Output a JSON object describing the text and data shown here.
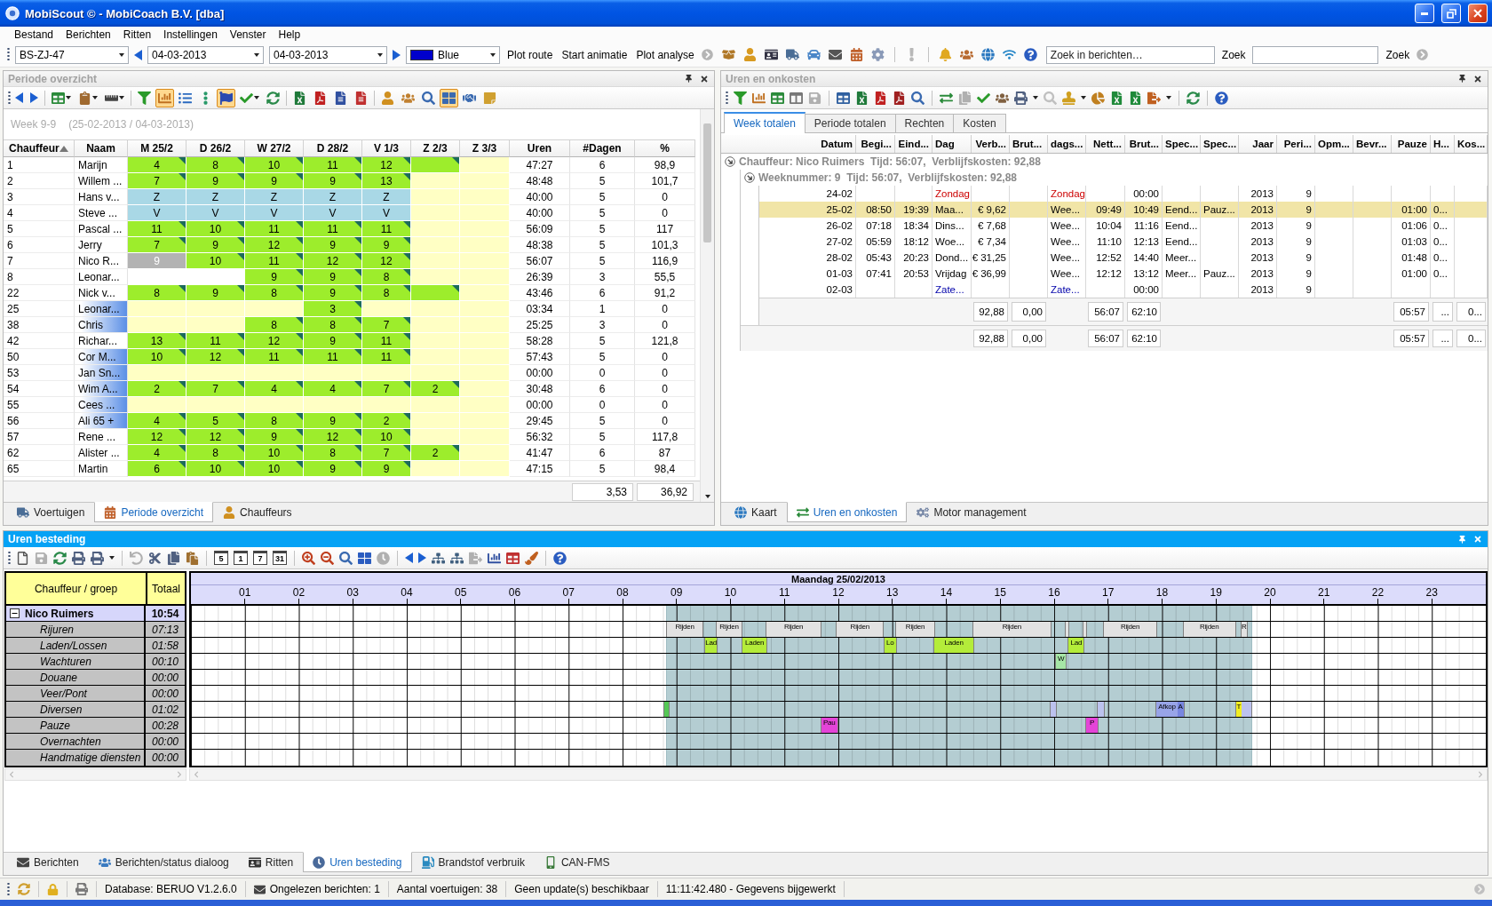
{
  "window": {
    "title": "MobiScout © - MobiCoach B.V. [dba]"
  },
  "menu": [
    "Bestand",
    "Berichten",
    "Ritten",
    "Instellingen",
    "Venster",
    "Help"
  ],
  "toolbar": {
    "vehicle": "BS-ZJ-47",
    "date_from": "04-03-2013",
    "date_to": "04-03-2013",
    "plot_color": {
      "label": "Blue",
      "color": "#0000cc"
    },
    "actions": [
      "Plot route",
      "Start animatie",
      "Plot analyse"
    ],
    "message_search": {
      "placeholder": "Zoek in berichten…",
      "button": "Zoek"
    },
    "search": {
      "button": "Zoek"
    }
  },
  "periode_overzicht": {
    "title": "Periode overzicht",
    "active": false,
    "toolbar": [
      {
        "selected": false
      },
      {
        "selected": false
      },
      {
        "selected": false
      },
      {
        "selected": false
      },
      {
        "selected": false
      },
      {
        "selected": false
      },
      {
        "selected": true
      },
      {
        "selected": false
      },
      {
        "selected": false
      },
      {
        "selected": true
      },
      {
        "selected": false
      },
      {
        "selected": false
      },
      {
        "selected": false
      },
      {
        "selected": false
      },
      {
        "selected": false
      },
      {
        "selected": false
      },
      {
        "selected": false
      },
      {
        "selected": false
      },
      {
        "selected": false
      },
      {
        "selected": true
      },
      {
        "selected": false
      },
      {
        "selected": false
      }
    ],
    "week": "Week 9-9",
    "range": "(25-02-2013 / 04-03-2013)",
    "columns": [
      {
        "label": "Chauffeur",
        "sorted": true
      },
      {
        "label": "Naam",
        "sorted": false
      },
      {
        "label": "M 25/2",
        "sorted": false
      },
      {
        "label": "D 26/2",
        "sorted": false
      },
      {
        "label": "W 27/2",
        "sorted": false
      },
      {
        "label": "D 28/2",
        "sorted": false
      },
      {
        "label": "V 1/3",
        "sorted": false
      },
      {
        "label": "Z 2/3",
        "sorted": false
      },
      {
        "label": "Z 3/3",
        "sorted": false
      },
      {
        "label": "Uren",
        "sorted": false
      },
      {
        "label": "#Dagen",
        "sorted": false
      },
      {
        "label": "%",
        "sorted": false
      }
    ],
    "rows": [
      {
        "id": "1",
        "name": "Marijn",
        "marked": false,
        "days": [
          {
            "kind": "worked",
            "value": "4"
          },
          {
            "kind": "worked",
            "value": "8"
          },
          {
            "kind": "worked",
            "value": "10"
          },
          {
            "kind": "worked",
            "value": "11"
          },
          {
            "kind": "worked",
            "value": "12"
          },
          {
            "kind": "worked"
          },
          {
            "kind": "free"
          }
        ],
        "hours": "47:27",
        "day_count": "6",
        "percent": "98,9"
      },
      {
        "id": "2",
        "name": "Willem ...",
        "marked": false,
        "days": [
          {
            "kind": "worked",
            "value": "7"
          },
          {
            "kind": "worked",
            "value": "9"
          },
          {
            "kind": "worked",
            "value": "9"
          },
          {
            "kind": "worked",
            "value": "9"
          },
          {
            "kind": "worked",
            "value": "13"
          },
          {
            "kind": "free"
          },
          {
            "kind": "free"
          }
        ],
        "hours": "48:48",
        "day_count": "5",
        "percent": "101,7"
      },
      {
        "id": "3",
        "name": "Hans v...",
        "marked": false,
        "days": [
          {
            "kind": "leave",
            "value": "Z"
          },
          {
            "kind": "leave",
            "value": "Z"
          },
          {
            "kind": "leave",
            "value": "Z"
          },
          {
            "kind": "leave",
            "value": "Z"
          },
          {
            "kind": "leave",
            "value": "Z"
          },
          {
            "kind": "free"
          },
          {
            "kind": "free"
          }
        ],
        "hours": "40:00",
        "day_count": "5",
        "percent": "0"
      },
      {
        "id": "4",
        "name": "Steve ...",
        "marked": false,
        "days": [
          {
            "kind": "leave",
            "value": "V"
          },
          {
            "kind": "leave",
            "value": "V"
          },
          {
            "kind": "leave",
            "value": "V"
          },
          {
            "kind": "leave",
            "value": "V"
          },
          {
            "kind": "leave",
            "value": "V"
          },
          {
            "kind": "free"
          },
          {
            "kind": "free"
          }
        ],
        "hours": "40:00",
        "day_count": "5",
        "percent": "0"
      },
      {
        "id": "5",
        "name": "Pascal ...",
        "marked": false,
        "days": [
          {
            "kind": "worked",
            "value": "11"
          },
          {
            "kind": "worked",
            "value": "10"
          },
          {
            "kind": "worked",
            "value": "11"
          },
          {
            "kind": "worked",
            "value": "11"
          },
          {
            "kind": "worked",
            "value": "11"
          },
          {
            "kind": "free"
          },
          {
            "kind": "free"
          }
        ],
        "hours": "56:09",
        "day_count": "5",
        "percent": "117"
      },
      {
        "id": "6",
        "name": "Jerry",
        "marked": false,
        "days": [
          {
            "kind": "worked",
            "value": "7"
          },
          {
            "kind": "worked",
            "value": "9"
          },
          {
            "kind": "worked",
            "value": "12"
          },
          {
            "kind": "worked",
            "value": "9"
          },
          {
            "kind": "worked",
            "value": "9"
          },
          {
            "kind": "free"
          },
          {
            "kind": "free"
          }
        ],
        "hours": "48:38",
        "day_count": "5",
        "percent": "101,3"
      },
      {
        "id": "7",
        "name": "Nico R...",
        "marked": false,
        "days": [
          {
            "kind": "current",
            "value": "9"
          },
          {
            "kind": "worked",
            "value": "10"
          },
          {
            "kind": "worked",
            "value": "11"
          },
          {
            "kind": "worked",
            "value": "12"
          },
          {
            "kind": "worked",
            "value": "12"
          },
          {
            "kind": "free"
          },
          {
            "kind": "free"
          }
        ],
        "hours": "56:07",
        "day_count": "5",
        "percent": "116,9"
      },
      {
        "id": "8",
        "name": "Leonar...",
        "marked": false,
        "days": [
          {
            "kind": "blank"
          },
          {
            "kind": "blank"
          },
          {
            "kind": "worked",
            "value": "9"
          },
          {
            "kind": "worked",
            "value": "9"
          },
          {
            "kind": "worked",
            "value": "8"
          },
          {
            "kind": "free"
          },
          {
            "kind": "free"
          }
        ],
        "hours": "26:39",
        "day_count": "3",
        "percent": "55,5"
      },
      {
        "id": "22",
        "name": "Nick v...",
        "marked": false,
        "days": [
          {
            "kind": "worked",
            "value": "8"
          },
          {
            "kind": "worked",
            "value": "9"
          },
          {
            "kind": "worked",
            "value": "8"
          },
          {
            "kind": "worked",
            "value": "9"
          },
          {
            "kind": "worked",
            "value": "8"
          },
          {
            "kind": "worked"
          },
          {
            "kind": "free"
          }
        ],
        "hours": "43:46",
        "day_count": "6",
        "percent": "91,2"
      },
      {
        "id": "25",
        "name": "Leonar...",
        "marked": true,
        "days": [
          {
            "kind": "free"
          },
          {
            "kind": "free"
          },
          {
            "kind": "free"
          },
          {
            "kind": "worked",
            "value": "3"
          },
          {
            "kind": "free"
          },
          {
            "kind": "free"
          },
          {
            "kind": "free"
          }
        ],
        "hours": "03:34",
        "day_count": "1",
        "percent": "0"
      },
      {
        "id": "38",
        "name": "Chris",
        "marked": true,
        "days": [
          {
            "kind": "free"
          },
          {
            "kind": "free"
          },
          {
            "kind": "worked",
            "value": "8"
          },
          {
            "kind": "worked",
            "value": "8"
          },
          {
            "kind": "worked",
            "value": "7"
          },
          {
            "kind": "free"
          },
          {
            "kind": "free"
          }
        ],
        "hours": "25:25",
        "day_count": "3",
        "percent": "0"
      },
      {
        "id": "42",
        "name": "Richar...",
        "marked": false,
        "days": [
          {
            "kind": "worked",
            "value": "13"
          },
          {
            "kind": "worked",
            "value": "11"
          },
          {
            "kind": "worked",
            "value": "12"
          },
          {
            "kind": "worked",
            "value": "9"
          },
          {
            "kind": "worked",
            "value": "11"
          },
          {
            "kind": "free"
          },
          {
            "kind": "free"
          }
        ],
        "hours": "58:28",
        "day_count": "5",
        "percent": "121,8"
      },
      {
        "id": "50",
        "name": "Cor M...",
        "marked": true,
        "days": [
          {
            "kind": "worked",
            "value": "10"
          },
          {
            "kind": "worked",
            "value": "12"
          },
          {
            "kind": "worked",
            "value": "11"
          },
          {
            "kind": "worked",
            "value": "11"
          },
          {
            "kind": "worked",
            "value": "11"
          },
          {
            "kind": "free"
          },
          {
            "kind": "free"
          }
        ],
        "hours": "57:43",
        "day_count": "5",
        "percent": "0"
      },
      {
        "id": "53",
        "name": "Jan Sn...",
        "marked": true,
        "days": [
          {
            "kind": "free"
          },
          {
            "kind": "free"
          },
          {
            "kind": "free"
          },
          {
            "kind": "free"
          },
          {
            "kind": "free"
          },
          {
            "kind": "free"
          },
          {
            "kind": "free"
          }
        ],
        "hours": "00:00",
        "day_count": "0",
        "percent": "0"
      },
      {
        "id": "54",
        "name": "Wim A...",
        "marked": true,
        "days": [
          {
            "kind": "worked",
            "value": "2"
          },
          {
            "kind": "worked",
            "value": "7"
          },
          {
            "kind": "worked",
            "value": "4"
          },
          {
            "kind": "worked",
            "value": "4"
          },
          {
            "kind": "worked",
            "value": "7"
          },
          {
            "kind": "worked",
            "value": "2"
          },
          {
            "kind": "free"
          }
        ],
        "hours": "30:48",
        "day_count": "6",
        "percent": "0"
      },
      {
        "id": "55",
        "name": "Cees ...",
        "marked": true,
        "days": [
          {
            "kind": "free"
          },
          {
            "kind": "free"
          },
          {
            "kind": "free"
          },
          {
            "kind": "free"
          },
          {
            "kind": "free"
          },
          {
            "kind": "free"
          },
          {
            "kind": "free"
          }
        ],
        "hours": "00:00",
        "day_count": "0",
        "percent": "0"
      },
      {
        "id": "56",
        "name": "Ali 65 +",
        "marked": true,
        "days": [
          {
            "kind": "worked",
            "value": "4"
          },
          {
            "kind": "worked",
            "value": "5"
          },
          {
            "kind": "worked",
            "value": "8"
          },
          {
            "kind": "worked",
            "value": "9"
          },
          {
            "kind": "worked",
            "value": "2"
          },
          {
            "kind": "free"
          },
          {
            "kind": "free"
          }
        ],
        "hours": "29:45",
        "day_count": "5",
        "percent": "0"
      },
      {
        "id": "57",
        "name": "Rene ...",
        "marked": false,
        "days": [
          {
            "kind": "worked",
            "value": "12"
          },
          {
            "kind": "worked",
            "value": "12"
          },
          {
            "kind": "worked",
            "value": "9"
          },
          {
            "kind": "worked",
            "value": "12"
          },
          {
            "kind": "worked",
            "value": "10"
          },
          {
            "kind": "free"
          },
          {
            "kind": "free"
          }
        ],
        "hours": "56:32",
        "day_count": "5",
        "percent": "117,8"
      },
      {
        "id": "62",
        "name": "Alister ...",
        "marked": false,
        "days": [
          {
            "kind": "worked",
            "value": "4"
          },
          {
            "kind": "worked",
            "value": "8"
          },
          {
            "kind": "worked",
            "value": "10"
          },
          {
            "kind": "worked",
            "value": "8"
          },
          {
            "kind": "worked",
            "value": "7"
          },
          {
            "kind": "worked",
            "value": "2"
          },
          {
            "kind": "free"
          }
        ],
        "hours": "41:47",
        "day_count": "6",
        "percent": "87"
      },
      {
        "id": "65",
        "name": "Martin",
        "marked": false,
        "days": [
          {
            "kind": "worked",
            "value": "6"
          },
          {
            "kind": "worked",
            "value": "10"
          },
          {
            "kind": "worked",
            "value": "10"
          },
          {
            "kind": "worked",
            "value": "9"
          },
          {
            "kind": "worked",
            "value": "9"
          },
          {
            "kind": "free"
          },
          {
            "kind": "free"
          }
        ],
        "hours": "47:15",
        "day_count": "5",
        "percent": "98,4"
      }
    ],
    "totals": [
      "3,53",
      "36,92"
    ],
    "tabs": [
      {
        "label": "Voertuigen",
        "selected": false
      },
      {
        "label": "Periode overzicht",
        "selected": true
      },
      {
        "label": "Chauffeurs",
        "selected": false
      }
    ]
  },
  "uren_en_onkosten": {
    "title": "Uren en onkosten",
    "active": false,
    "view_tabs": [
      {
        "label": "Week totalen",
        "selected": true
      },
      {
        "label": "Periode totalen",
        "selected": false
      },
      {
        "label": "Rechten",
        "selected": false
      },
      {
        "label": "Kosten",
        "selected": false
      }
    ],
    "columns": [
      "Datum",
      "Begi...",
      "Eind...",
      "Dag",
      "Verb...",
      "Brut...",
      "dags...",
      "Nett...",
      "Brut...",
      "Spec...",
      "Spec...",
      "Jaar",
      "Peri...",
      "Opm...",
      "Bevr...",
      "Pauze",
      "H...",
      "Kos..."
    ],
    "group": {
      "label": "Chauffeur: Nico Ruimers  Tijd: 56:07,  Verblijfskosten: 92,88",
      "expanded": true,
      "subgroup": {
        "label": "Weeknummer: 9  Tijd: 56:07,  Verblijfskosten: 92,88",
        "expanded": true,
        "rows": [
          {
            "selected": false,
            "kind": "sunday",
            "column_1": "24-02",
            "column_4": "Zondag",
            "column_7": "Zondag",
            "column_9": "00:00",
            "column_12": "2013",
            "column_13": "9"
          },
          {
            "selected": true,
            "kind": "weekday",
            "column_1": "25-02",
            "column_2": "08:50",
            "column_3": "19:39",
            "column_4": "Maa...",
            "column_5": "€ 9,62",
            "column_7": "Wee...",
            "column_8": "09:49",
            "column_9": "10:49",
            "column_10": "Eend...",
            "column_11": "Pauz...",
            "column_12": "2013",
            "column_13": "9",
            "column_16": "01:00",
            "column_17": "0..."
          },
          {
            "selected": false,
            "kind": "weekday",
            "column_1": "26-02",
            "column_2": "07:18",
            "column_3": "18:34",
            "column_4": "Dins...",
            "column_5": "€ 7,68",
            "column_7": "Wee...",
            "column_8": "10:04",
            "column_9": "11:16",
            "column_10": "Eend...",
            "column_12": "2013",
            "column_13": "9",
            "column_16": "01:06",
            "column_17": "0..."
          },
          {
            "selected": false,
            "kind": "weekday",
            "column_1": "27-02",
            "column_2": "05:59",
            "column_3": "18:12",
            "column_4": "Woe...",
            "column_5": "€ 7,34",
            "column_7": "Wee...",
            "column_8": "11:10",
            "column_9": "12:13",
            "column_10": "Eend...",
            "column_12": "2013",
            "column_13": "9",
            "column_16": "01:03",
            "column_17": "0..."
          },
          {
            "selected": false,
            "kind": "weekday",
            "column_1": "28-02",
            "column_2": "05:43",
            "column_3": "20:23",
            "column_4": "Dond...",
            "column_5": "€ 31,25",
            "column_7": "Wee...",
            "column_8": "12:52",
            "column_9": "14:40",
            "column_10": "Meer...",
            "column_12": "2013",
            "column_13": "9",
            "column_16": "01:48",
            "column_17": "0..."
          },
          {
            "selected": false,
            "kind": "weekday",
            "column_1": "01-03",
            "column_2": "07:41",
            "column_3": "20:53",
            "column_4": "Vrijdag",
            "column_5": "€ 36,99",
            "column_7": "Wee...",
            "column_8": "12:12",
            "column_9": "13:12",
            "column_10": "Meer...",
            "column_11": "Pauz...",
            "column_12": "2013",
            "column_13": "9",
            "column_16": "01:00",
            "column_17": "0..."
          },
          {
            "selected": false,
            "kind": "saturday",
            "column_1": "02-03",
            "column_4": "Zate...",
            "column_7": "Zate...",
            "column_9": "00:00",
            "column_12": "2013",
            "column_13": "9"
          }
        ],
        "totals": {
          "column_5": "92,88",
          "column_6": "0,00",
          "column_8": "56:07",
          "column_9": "62:10",
          "column_16": "05:57",
          "column_17": "...",
          "column_18": "0..."
        }
      },
      "totals": {
        "column_5": "92,88",
        "column_6": "0,00",
        "column_8": "56:07",
        "column_9": "62:10",
        "column_16": "05:57",
        "column_17": "...",
        "column_18": "0..."
      }
    },
    "tabs": [
      {
        "label": "Kaart",
        "selected": false
      },
      {
        "label": "Uren en onkosten",
        "selected": true
      },
      {
        "label": "Motor management",
        "selected": false
      }
    ]
  },
  "uren_besteding": {
    "title": "Uren besteding",
    "active": true,
    "calendar_buttons": [
      "5",
      "1",
      "7",
      "31"
    ],
    "columns": [
      "Chauffeur / groep",
      "Totaal"
    ],
    "date": "Maandag 25/02/2013",
    "hours": [
      "01",
      "02",
      "03",
      "04",
      "05",
      "06",
      "07",
      "08",
      "09",
      "10",
      "11",
      "12",
      "13",
      "14",
      "15",
      "16",
      "17",
      "18",
      "19",
      "20",
      "21",
      "22",
      "23"
    ],
    "active_period": {
      "color": "#b4cdd2",
      "start": {
        "level": 0.3679
      },
      "end": {
        "level": 0.8188
      }
    },
    "group": {
      "name": "Nico Ruimers",
      "total": "10:54",
      "expanded": true,
      "children": [
        {
          "name": "Rijuren",
          "total": "07:13",
          "bars": [
            {
              "label": "Rijden",
              "color": "#e2e2e2",
              "start": {
                "level": 0.3679
              },
              "end": {
                "level": 0.395
              }
            },
            {
              "label": "Rijden",
              "color": "#e2e2e2",
              "start": {
                "level": 0.4063
              },
              "end": {
                "level": 0.425
              }
            },
            {
              "label": "Rijden",
              "color": "#e2e2e2",
              "start": {
                "level": 0.4446
              },
              "end": {
                "level": 0.4863
              }
            },
            {
              "label": "Rijden",
              "color": "#e2e2e2",
              "start": {
                "level": 0.4988
              },
              "end": {
                "level": 0.5346
              }
            },
            {
              "label": "Rijden",
              "color": "#e2e2e2",
              "start": {
                "level": 0.5446
              },
              "end": {
                "level": 0.5742
              }
            },
            {
              "label": "Rijden",
              "color": "#e2e2e2",
              "start": {
                "level": 0.6042
              },
              "end": {
                "level": 0.6638
              }
            },
            {
              "color": "#e2e2e2",
              "start": {
                "level": 0.6758
              },
              "end": {
                "level": 0.6779
              }
            },
            {
              "color": "#e2e2e2",
              "start": {
                "level": 0.6896
              },
              "end": {
                "level": 0.6917
              }
            },
            {
              "label": "Rijden",
              "color": "#e2e2e2",
              "start": {
                "level": 0.705
              },
              "end": {
                "level": 0.7458
              }
            },
            {
              "label": "Rijden",
              "color": "#e2e2e2",
              "start": {
                "level": 0.7667
              },
              "end": {
                "level": 0.8063
              }
            },
            {
              "label": "R",
              "color": "#e2e2e2",
              "start": {
                "level": 0.8113
              },
              "end": {
                "level": 0.8154
              }
            }
          ]
        },
        {
          "name": "Laden/Lossen",
          "total": "01:58",
          "bars": [
            {
              "label": "Lad",
              "color": "#b4ec3a",
              "start": {
                "level": 0.3971
              },
              "end": {
                "level": 0.4063
              }
            },
            {
              "label": "Laden",
              "color": "#b4ec3a",
              "start": {
                "level": 0.4258
              },
              "end": {
                "level": 0.4446
              }
            },
            {
              "label": "Lo",
              "color": "#b4ec3a",
              "start": {
                "level": 0.5354
              },
              "end": {
                "level": 0.5446
              }
            },
            {
              "label": "Laden",
              "color": "#b4ec3a",
              "start": {
                "level": 0.5742
              },
              "end": {
                "level": 0.6042
              }
            },
            {
              "label": "Lad",
              "color": "#b4ec3a",
              "start": {
                "level": 0.6779
              },
              "end": {
                "level": 0.6896
              }
            }
          ]
        },
        {
          "name": "Wachturen",
          "total": "00:10",
          "bars": [
            {
              "label": "W",
              "color": "#a6e6a6",
              "start": {
                "level": 0.6679
              },
              "end": {
                "level": 0.6758
              }
            }
          ]
        },
        {
          "name": "Douane",
          "total": "00:00"
        },
        {
          "name": "Veer/Pont",
          "total": "00:00"
        },
        {
          "name": "Diversen",
          "total": "01:02",
          "bars": [
            {
              "color": "#55c855",
              "start": {
                "level": 0.3658
              },
              "end": {
                "level": 0.3688
              }
            },
            {
              "color": "#bcc2ee",
              "start": {
                "level": 0.6638
              },
              "end": {
                "level": 0.6679
              }
            },
            {
              "color": "#bcc2ee",
              "start": {
                "level": 0.7
              },
              "end": {
                "level": 0.705
              }
            },
            {
              "label": "Afkop",
              "color": "#98a4e8",
              "start": {
                "level": 0.7458
              },
              "end": {
                "level": 0.7617
              }
            },
            {
              "label": "A",
              "color": "#7886e0",
              "start": {
                "level": 0.7617
              },
              "end": {
                "level": 0.7667
              }
            },
            {
              "label": "T",
              "color": "#f2ee22",
              "start": {
                "level": 0.8071
              },
              "end": {
                "level": 0.8113
              }
            },
            {
              "color": "#bcc2ee",
              "start": {
                "level": 0.8113
              },
              "end": {
                "level": 0.8188
              }
            }
          ]
        },
        {
          "name": "Pauze",
          "total": "00:28",
          "bars": [
            {
              "label": "Pau",
              "color": "#e444d8",
              "start": {
                "level": 0.4867
              },
              "end": {
                "level": 0.4992
              }
            },
            {
              "label": "P",
              "color": "#e444d8",
              "start": {
                "level": 0.6917
              },
              "end": {
                "level": 0.7
              }
            }
          ]
        },
        {
          "name": "Overnachten",
          "total": "00:00"
        },
        {
          "name": "Handmatige diensten",
          "total": "00:00"
        }
      ]
    },
    "tabs": [
      {
        "label": "Berichten",
        "selected": false
      },
      {
        "label": "Berichten/status dialoog",
        "selected": false
      },
      {
        "label": "Ritten",
        "selected": false
      },
      {
        "label": "Uren besteding",
        "selected": true
      },
      {
        "label": "Brandstof verbruik",
        "selected": false
      },
      {
        "label": "CAN-FMS",
        "selected": false
      }
    ]
  },
  "status_bar": [
    "Database: BERUO V1.2.6.0",
    "Ongelezen berichten: 1",
    "Aantal voertuigen: 38",
    "Geen update(s) beschikbaar",
    "11:11:42.480 - Gegevens bijgewerkt"
  ]
}
